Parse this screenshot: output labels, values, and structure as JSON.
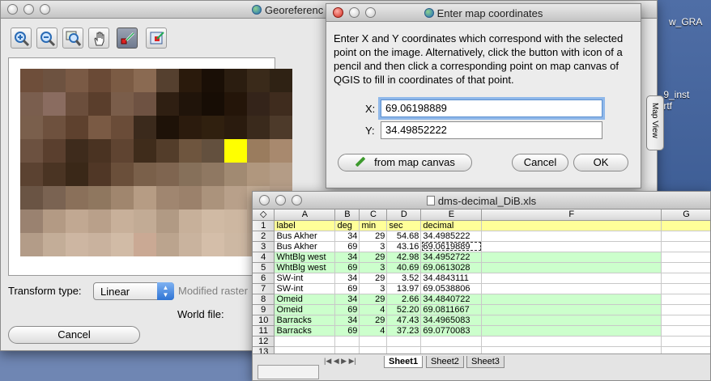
{
  "desktop": {
    "items": [
      "w_GRA",
      ".9_inst",
      ".rtf"
    ]
  },
  "georeferencer": {
    "title": "Georeferenc",
    "transform_label": "Transform type:",
    "transform_value": "Linear",
    "modified_label": "Modified raster",
    "world_file_label": "World file:",
    "cancel_label": "Cancel",
    "tools": [
      "zoom-in-icon",
      "zoom-out-icon",
      "zoom-to-layer-icon",
      "pan-hand-icon",
      "add-point-icon",
      "delete-point-icon"
    ]
  },
  "dialog": {
    "title": "Enter map coordinates",
    "text": "Enter X and Y coordinates which correspond with the selected point on the image. Alternatively, click the button with icon of a pencil and then click a corresponding point on map canvas of QGIS to fill in coordinates of that point.",
    "x_label": "X:",
    "x_value": "69.06198889",
    "y_label": "Y:",
    "y_value": "34.49852222",
    "from_canvas_label": "from map canvas",
    "cancel_label": "Cancel",
    "ok_label": "OK"
  },
  "map_view_tab": "Map View",
  "spreadsheet": {
    "title": "dms-decimal_DiB.xls",
    "columns": [
      "A",
      "B",
      "C",
      "D",
      "E",
      "F",
      "G"
    ],
    "rows": [
      [
        "label",
        "deg",
        "min",
        "sec",
        "decimal"
      ],
      [
        "Bus Akher",
        "34",
        "29",
        "54.68",
        "34.4985222"
      ],
      [
        "Bus Akher",
        "69",
        "3",
        "43.16",
        "69.0619889"
      ],
      [
        "WhtBlg west",
        "34",
        "29",
        "42.98",
        "34.4952722"
      ],
      [
        "WhtBlg west",
        "69",
        "3",
        "40.69",
        "69.0613028"
      ],
      [
        "SW-int",
        "34",
        "29",
        "3.52",
        "34.4843111"
      ],
      [
        "SW-int",
        "69",
        "3",
        "13.97",
        "69.0538806"
      ],
      [
        "Omeid",
        "34",
        "29",
        "2.66",
        "34.4840722"
      ],
      [
        "Omeid",
        "69",
        "4",
        "52.20",
        "69.0811667"
      ],
      [
        "Barracks",
        "34",
        "29",
        "47.43",
        "34.4965083"
      ],
      [
        "Barracks",
        "69",
        "4",
        "37.23",
        "69.0770083"
      ],
      [
        "",
        "",
        "",
        "",
        ""
      ],
      [
        "",
        "",
        "",
        "",
        ""
      ]
    ],
    "sheets": [
      "Sheet1",
      "Sheet2",
      "Sheet3"
    ]
  },
  "colors": {
    "header_row": "#ffff99",
    "highlight_rows": "#ccffcc",
    "selected_pixel": "#ffff00",
    "focus_ring": "#8fb8ea"
  }
}
